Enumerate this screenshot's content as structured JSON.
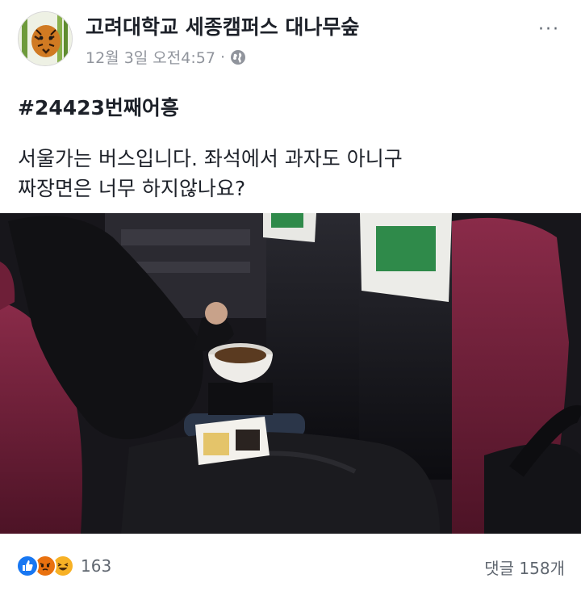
{
  "post": {
    "page_name": "고려대학교 세종캠퍼스 대나무숲",
    "timestamp": "12월 3일 오전4:57",
    "separator": "·",
    "privacy_icon": "globe-icon",
    "more_menu": "···",
    "hashtag": "#24423번째어흥",
    "body_lines": [
      "서울가는 버스입니다. 좌석에서 과자도 아니구",
      "짜장면은 너무 하지않나요?"
    ],
    "photo_description_icon": "bus-photo"
  },
  "footer": {
    "reaction_icons": [
      "like-icon",
      "angry-icon",
      "haha-icon"
    ],
    "reaction_count": "163",
    "comments_label": "댓글 158개"
  },
  "colors": {
    "name_text": "#1d2129",
    "meta_text": "#90949c",
    "like_blue": "#1877f2",
    "angry_red": "#e9710f",
    "haha_yellow": "#f7b125",
    "seat_maroon": "#7a2340"
  }
}
